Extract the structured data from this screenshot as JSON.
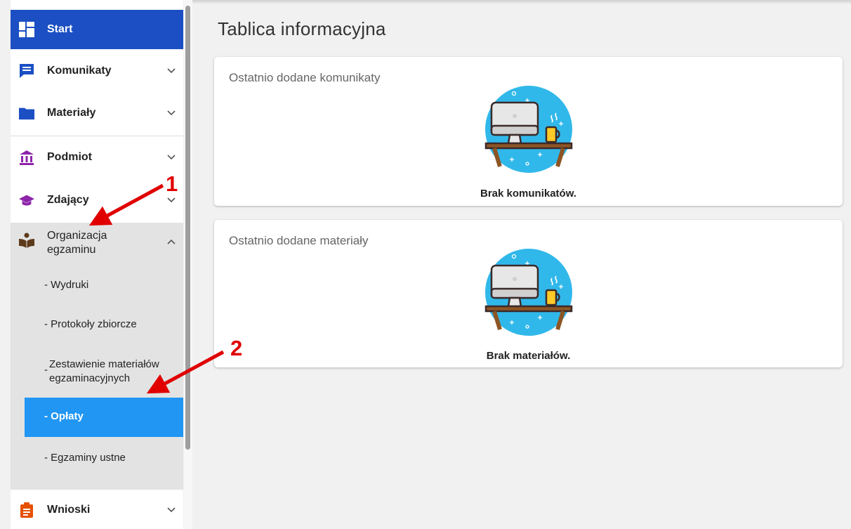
{
  "sidebar": {
    "start_label": "Start",
    "items": [
      {
        "label": "Komunikaty",
        "icon": "message-icon"
      },
      {
        "label": "Materiały",
        "icon": "folder-icon"
      },
      {
        "label": "Podmiot",
        "icon": "institution-icon"
      },
      {
        "label": "Zdający",
        "icon": "graduation-cap-icon"
      },
      {
        "label_line1": "Organizacja",
        "label_line2": "egzaminu",
        "icon": "reading-person-icon"
      },
      {
        "label": "Wnioski",
        "icon": "clipboard-icon"
      }
    ],
    "subitems": [
      {
        "label": "- Wydruki"
      },
      {
        "label": "- Protokoły zbiorcze"
      },
      {
        "label_prefix": "-",
        "label_line1": "Zestawienie materiałów",
        "label_line2": "egzaminacyjnych"
      },
      {
        "label": "- Opłaty",
        "active": true
      },
      {
        "label": "- Egzaminy ustne"
      }
    ]
  },
  "main": {
    "title": "Tablica informacyjna",
    "cards": [
      {
        "heading": "Ostatnio dodane komunikaty",
        "empty_text": "Brak komunikatów."
      },
      {
        "heading": "Ostatnio dodane materiały",
        "empty_text": "Brak materiałów."
      }
    ]
  },
  "annotations": [
    {
      "number": "1"
    },
    {
      "number": "2"
    }
  ],
  "colors": {
    "start_bg": "#1b4fc3",
    "active_sub_bg": "#2196f3",
    "annotation": "#e00000",
    "illustration_circle": "#31b8ea"
  }
}
